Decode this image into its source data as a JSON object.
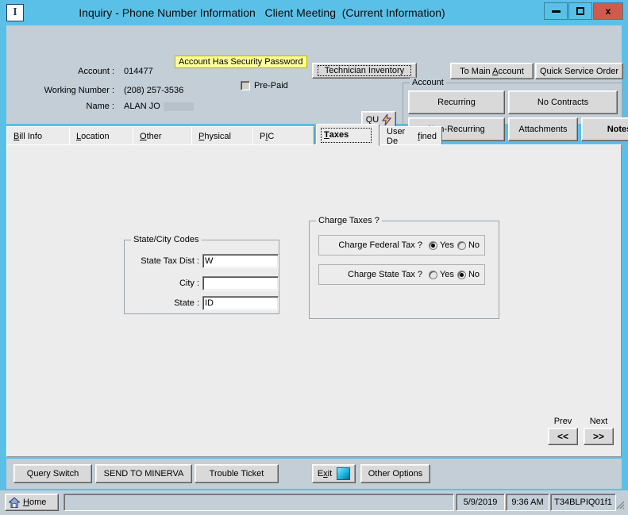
{
  "window": {
    "title": "Inquiry - Phone Number Information   Client Meeting  (Current Information)",
    "app_icon_letter": "I",
    "minimize_label": "Minimize",
    "maximize_label": "Maximize",
    "close_label": "x"
  },
  "header": {
    "security_banner": "Account Has Security Password",
    "prepaid_label": "Pre-Paid",
    "account_label": "Account :",
    "account_value": "014477",
    "working_number_label": "Working Number :",
    "working_number_value": "(208) 257-3536",
    "name_label": "Name :",
    "name_value": "ALAN JO",
    "technician_inventory": "Technician Inventory",
    "to_main_account": "To Main Account",
    "quick_service_order": "Quick Service Order",
    "qu_label": "QU"
  },
  "account_group": {
    "title": "Account",
    "buttons": [
      {
        "label": "Recurring",
        "bold": false
      },
      {
        "label": "No Contracts",
        "bold": false
      },
      {
        "label": "Non-Recurring",
        "bold": false
      },
      {
        "label": "Attachments",
        "bold": false
      },
      {
        "label": "Notes",
        "bold": true
      }
    ]
  },
  "tabs": [
    {
      "label": "Bill Info",
      "mnemonic": "B",
      "selected": false
    },
    {
      "label": "Location",
      "mnemonic": "L",
      "selected": false
    },
    {
      "label": "Other",
      "mnemonic": "O",
      "selected": false
    },
    {
      "label": "Physical",
      "mnemonic": "P",
      "selected": false
    },
    {
      "label": "PIC",
      "mnemonic": "I",
      "selected": false
    },
    {
      "label": "Taxes",
      "mnemonic": "T",
      "selected": true
    },
    {
      "label": "User Defined",
      "mnemonic": "f",
      "selected": false
    }
  ],
  "state_city": {
    "title": "State/City Codes",
    "fields": [
      {
        "label": "State Tax Dist :",
        "value": "W"
      },
      {
        "label": "City :",
        "value": ""
      },
      {
        "label": "State :",
        "value": "ID"
      }
    ]
  },
  "charge_taxes": {
    "title": "Charge Taxes ?",
    "rows": [
      {
        "label": "Charge Federal Tax ?",
        "yes_label": "Yes",
        "no_label": "No",
        "selected": "Yes"
      },
      {
        "label": "Charge State Tax ?",
        "yes_label": "Yes",
        "no_label": "No",
        "selected": "No"
      }
    ]
  },
  "navigation": {
    "prev_caption": "Prev",
    "prev_glyph": "<<",
    "next_caption": "Next",
    "next_glyph": ">>"
  },
  "bottom_bar": {
    "query_switch": "Query Switch",
    "send_to_minerva": "SEND TO MINERVA",
    "trouble_ticket": "Trouble Ticket",
    "exit": "Exit",
    "other_options": "Other Options"
  },
  "status_bar": {
    "home": "Home",
    "message": "",
    "date": "5/9/2019",
    "time": "9:36 AM",
    "session": "T34BLPIQ01f1"
  },
  "colors": {
    "title_bar": "#5bc0e8",
    "close_button": "#cf5b4d",
    "header_panel": "#c3ced6",
    "body_panel": "#ececec",
    "security_banner": "#ffff99"
  }
}
